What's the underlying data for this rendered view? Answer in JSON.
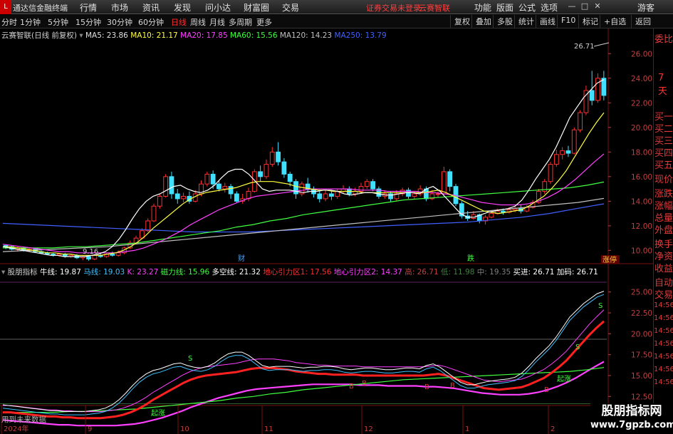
{
  "app": {
    "logo": "L",
    "title": "通达信金融终端"
  },
  "menu": [
    "行情",
    "市场",
    "资讯",
    "发现",
    "问小达",
    "财富圈",
    "交易"
  ],
  "notice": [
    "证券交易未登录",
    "云赛智联"
  ],
  "rmenu": [
    "功能",
    "版面",
    "公式",
    "选项"
  ],
  "guest": "游客",
  "window_icons": [
    "minimize-icon",
    "restore-icon",
    "close-icon"
  ],
  "periods": [
    "分时",
    "1分钟",
    "5分钟",
    "15分钟",
    "30分钟",
    "60分钟",
    "日线",
    "周线",
    "月线",
    "多周期",
    "更多"
  ],
  "active_period": "日线",
  "toolbar": [
    "复权",
    "叠加",
    "多股",
    "统计",
    "画线",
    "F10",
    "标记",
    "+自选",
    "返回"
  ],
  "legend_main": {
    "stock": "云赛智联(日线 前复权)",
    "ma5": "MA5: 23.86",
    "ma10": "MA10: 21.17",
    "ma20": "MA20: 17.85",
    "ma60": "MA60: 15.56",
    "ma120": "MA120: 14.23",
    "ma250": "MA250: 13.79"
  },
  "colors": {
    "ma5": "#ffffff",
    "ma10": "#ffff40",
    "ma20": "#ff40ff",
    "ma60": "#40ff40",
    "ma120": "#c0c0c0",
    "ma250": "#4060ff",
    "up": "#ff3030",
    "down": "#40e0ff",
    "axis": "#c04040"
  },
  "high_label": "26.71",
  "low_label": "9.16",
  "y_main": [
    "26.00",
    "24.00",
    "22.00",
    "20.00",
    "18.00",
    "16.00",
    "14.00",
    "12.00",
    "10.00"
  ],
  "main_markers": {
    "cai": "财",
    "die": "跌",
    "zhangting": "涨停"
  },
  "legend_ind": {
    "name": "股朋指标",
    "n1": "牛线: 19.87",
    "n2": "马线: 19.03",
    "n3": "K: 23.27",
    "n4": "磁力线: 15.96",
    "n5": "多空线: 21.32",
    "n6": "地心引力区1: 17.56",
    "n7": "地心引力区2: 14.37",
    "n8": "高: 26.71",
    "n9": "低: 11.98",
    "n10": "中: 19.35",
    "n11": "买进: 26.71",
    "n12": "加码: 26.71"
  },
  "y_ind": [
    "25.00",
    "22.50",
    "20.00",
    "17.50",
    "15.00",
    "12.50"
  ],
  "sell_signal": "S",
  "buy_signal": "B",
  "cross_signal": "起涨",
  "x_labels": [
    "2024年",
    "9",
    "10",
    "11",
    "12",
    "1",
    "2"
  ],
  "footer_text": "用到未来数据",
  "side_panel": {
    "top": "委比",
    "top_val": "7天",
    "items": [
      "买一",
      "买二",
      "买三",
      "买四",
      "买五",
      "现价",
      "涨跌",
      "涨幅",
      "总量",
      "外盘",
      "换手",
      "净资",
      "收益"
    ],
    "bottom": [
      "自动",
      "交易"
    ],
    "ticks": [
      "14:56",
      "14:56",
      "14:56",
      "14:56",
      "14:56",
      "14:56",
      "14:56"
    ]
  },
  "watermark": {
    "line1": "股朋指标网",
    "line2": "www.7gpzb.com"
  },
  "chart_data": {
    "type": "candlestick",
    "title": "云赛智联(日线 前复权)",
    "x": [
      "2024年",
      "9",
      "10",
      "11",
      "12",
      "1",
      "2"
    ],
    "ylim": [
      9.5,
      27
    ],
    "candles": [
      [
        10.4,
        10.3,
        10.5,
        10.1
      ],
      [
        10.3,
        10.1,
        10.4,
        10.0
      ],
      [
        10.1,
        10.2,
        10.3,
        9.9
      ],
      [
        10.2,
        10.0,
        10.3,
        9.9
      ],
      [
        10.0,
        10.1,
        10.2,
        9.9
      ],
      [
        10.1,
        9.9,
        10.2,
        9.8
      ],
      [
        9.9,
        9.8,
        10.0,
        9.7
      ],
      [
        9.8,
        9.7,
        9.9,
        9.6
      ],
      [
        9.7,
        9.6,
        9.8,
        9.5
      ],
      [
        9.6,
        9.7,
        9.8,
        9.5
      ],
      [
        9.7,
        9.5,
        9.8,
        9.4
      ],
      [
        9.5,
        9.6,
        9.7,
        9.4
      ],
      [
        9.6,
        9.4,
        9.7,
        9.3
      ],
      [
        9.4,
        9.5,
        9.6,
        9.2
      ],
      [
        9.5,
        9.3,
        9.6,
        9.16
      ],
      [
        9.3,
        9.6,
        9.7,
        9.2
      ],
      [
        9.6,
        9.5,
        9.8,
        9.4
      ],
      [
        9.5,
        9.7,
        9.8,
        9.4
      ],
      [
        9.7,
        9.6,
        9.9,
        9.5
      ],
      [
        9.6,
        9.8,
        10.0,
        9.5
      ],
      [
        9.8,
        10.2,
        10.3,
        9.7
      ],
      [
        10.2,
        10.6,
        10.8,
        10.1
      ],
      [
        10.6,
        11.0,
        11.2,
        10.5
      ],
      [
        11.0,
        11.6,
        11.8,
        10.9
      ],
      [
        11.6,
        12.4,
        12.6,
        11.5
      ],
      [
        12.4,
        13.6,
        13.8,
        12.3
      ],
      [
        13.6,
        14.4,
        14.6,
        13.4
      ],
      [
        14.4,
        16.0,
        16.2,
        14.3
      ],
      [
        16.0,
        14.6,
        16.4,
        14.2
      ],
      [
        14.6,
        14.2,
        15.0,
        13.8
      ],
      [
        14.2,
        14.4,
        14.7,
        13.9
      ],
      [
        14.4,
        14.0,
        14.8,
        13.8
      ],
      [
        14.0,
        14.6,
        14.9,
        13.9
      ],
      [
        14.6,
        15.4,
        15.7,
        14.4
      ],
      [
        15.4,
        16.2,
        16.4,
        15.2
      ],
      [
        16.2,
        15.4,
        16.5,
        15.0
      ],
      [
        15.4,
        15.0,
        15.7,
        14.8
      ],
      [
        15.0,
        15.2,
        15.5,
        14.7
      ],
      [
        15.2,
        14.6,
        15.4,
        14.2
      ],
      [
        14.6,
        14.0,
        14.8,
        13.9
      ],
      [
        14.0,
        14.2,
        14.6,
        13.8
      ],
      [
        14.2,
        14.8,
        15.1,
        14.0
      ],
      [
        14.8,
        16.4,
        16.6,
        14.7
      ],
      [
        16.4,
        16.0,
        16.9,
        15.6
      ],
      [
        16.0,
        17.0,
        17.4,
        15.8
      ],
      [
        17.0,
        18.0,
        18.4,
        16.8
      ],
      [
        18.0,
        17.2,
        18.8,
        16.9
      ],
      [
        17.2,
        16.2,
        17.5,
        15.9
      ],
      [
        16.2,
        15.6,
        16.4,
        15.2
      ],
      [
        15.6,
        14.6,
        15.8,
        14.2
      ],
      [
        14.6,
        15.4,
        15.6,
        14.4
      ],
      [
        15.4,
        15.0,
        15.9,
        14.7
      ],
      [
        15.0,
        14.6,
        15.2,
        14.3
      ],
      [
        14.6,
        14.2,
        14.8,
        13.9
      ],
      [
        14.2,
        14.6,
        14.9,
        14.0
      ],
      [
        14.6,
        14.4,
        14.9,
        14.1
      ],
      [
        14.4,
        14.8,
        15.0,
        14.2
      ],
      [
        14.8,
        15.0,
        15.3,
        14.6
      ],
      [
        15.0,
        14.6,
        15.2,
        14.4
      ],
      [
        14.6,
        14.8,
        15.1,
        14.4
      ],
      [
        14.8,
        15.2,
        15.5,
        14.6
      ],
      [
        15.2,
        15.6,
        15.8,
        15.0
      ],
      [
        15.6,
        15.0,
        15.8,
        14.8
      ],
      [
        15.0,
        14.4,
        15.2,
        14.2
      ],
      [
        14.4,
        14.6,
        14.9,
        14.2
      ],
      [
        14.6,
        14.2,
        14.8,
        13.9
      ],
      [
        14.2,
        14.6,
        14.9,
        14.0
      ],
      [
        14.6,
        14.9,
        15.1,
        14.4
      ],
      [
        14.9,
        14.4,
        15.1,
        14.2
      ],
      [
        14.4,
        14.6,
        14.8,
        14.2
      ],
      [
        14.6,
        15.0,
        15.3,
        14.4
      ],
      [
        15.0,
        14.2,
        15.2,
        14.0
      ],
      [
        14.2,
        14.6,
        14.9,
        14.1
      ],
      [
        14.6,
        14.6,
        14.8,
        14.3
      ],
      [
        14.6,
        16.4,
        16.8,
        14.5
      ],
      [
        16.4,
        15.2,
        16.6,
        14.8
      ],
      [
        15.2,
        13.8,
        15.4,
        13.6
      ],
      [
        13.8,
        12.8,
        14.0,
        12.6
      ],
      [
        12.8,
        12.6,
        13.2,
        12.4
      ],
      [
        12.6,
        12.9,
        13.2,
        12.5
      ],
      [
        12.9,
        12.4,
        13.0,
        12.2
      ],
      [
        12.4,
        12.7,
        12.9,
        12.1
      ],
      [
        12.7,
        13.0,
        13.2,
        12.6
      ],
      [
        13.0,
        13.2,
        13.4,
        12.9
      ],
      [
        13.2,
        13.1,
        13.4,
        12.9
      ],
      [
        13.1,
        13.3,
        13.5,
        13.0
      ],
      [
        13.3,
        13.4,
        13.6,
        13.1
      ],
      [
        13.4,
        13.2,
        13.7,
        13.0
      ],
      [
        13.2,
        13.5,
        13.7,
        13.1
      ],
      [
        13.5,
        13.9,
        14.1,
        13.4
      ],
      [
        13.9,
        14.8,
        15.0,
        13.8
      ],
      [
        14.8,
        15.6,
        15.8,
        14.6
      ],
      [
        15.6,
        17.0,
        17.2,
        15.4
      ],
      [
        17.0,
        17.8,
        18.2,
        16.8
      ],
      [
        17.8,
        18.1,
        18.4,
        17.4
      ],
      [
        18.1,
        17.9,
        18.5,
        17.6
      ],
      [
        17.9,
        19.8,
        20.0,
        17.8
      ],
      [
        19.8,
        21.2,
        21.4,
        19.6
      ],
      [
        21.2,
        23.0,
        23.4,
        21.0
      ],
      [
        23.0,
        22.2,
        24.6,
        21.8
      ],
      [
        22.2,
        24.0,
        24.4,
        22.0
      ],
      [
        24.0,
        22.6,
        24.6,
        22.2
      ]
    ],
    "ma5": [
      10.3,
      10.2,
      10.1,
      10.0,
      9.9,
      9.8,
      9.7,
      9.6,
      9.6,
      9.5,
      9.5,
      9.5,
      9.5,
      9.6,
      9.7,
      9.9,
      10.3,
      10.9,
      11.7,
      12.6,
      13.4,
      14.0,
      14.4,
      14.6,
      14.9,
      15.2,
      15.3,
      15.0,
      14.8,
      14.7,
      14.9,
      15.3,
      15.9,
      16.4,
      16.6,
      16.6,
      16.2,
      15.6,
      15.0,
      14.8,
      14.9,
      14.9,
      14.9,
      14.8,
      14.7,
      14.8,
      14.8,
      14.9,
      14.9,
      14.8,
      14.6,
      14.5,
      14.6,
      14.7,
      14.7,
      14.6,
      14.5,
      14.5,
      14.6,
      14.7,
      14.7,
      14.6,
      15.0,
      15.2,
      14.8,
      14.2,
      13.6,
      13.0,
      12.7,
      12.7,
      12.9,
      13.1,
      13.2,
      13.3,
      13.4,
      13.6,
      14.1,
      14.9,
      15.8,
      16.6,
      17.4,
      18.4,
      19.6,
      20.8,
      21.6,
      22.4,
      23.0,
      23.6,
      23.9
    ],
    "ma10": [
      10.3,
      10.3,
      10.2,
      10.1,
      10.0,
      9.9,
      9.8,
      9.8,
      9.7,
      9.7,
      9.6,
      9.6,
      9.6,
      9.6,
      9.7,
      9.8,
      10.0,
      10.3,
      10.7,
      11.2,
      11.8,
      12.3,
      12.8,
      13.3,
      13.8,
      14.2,
      14.5,
      14.7,
      14.8,
      14.9,
      15.0,
      15.1,
      15.3,
      15.5,
      15.6,
      15.6,
      15.6,
      15.5,
      15.4,
      15.2,
      15.1,
      15.0,
      14.9,
      14.9,
      14.8,
      14.8,
      14.8,
      14.8,
      14.7,
      14.7,
      14.7,
      14.7,
      14.7,
      14.7,
      14.7,
      14.7,
      14.7,
      14.8,
      14.9,
      14.7,
      14.4,
      14.1,
      13.8,
      13.5,
      13.2,
      13.1,
      13.0,
      13.1,
      13.2,
      13.3,
      13.6,
      14.0,
      14.4,
      15.0,
      15.7,
      16.5,
      17.5,
      18.5,
      19.5,
      20.4,
      21.2
    ],
    "ma20": [
      10.5,
      10.4,
      10.3,
      10.2,
      10.1,
      10.0,
      9.9,
      9.9,
      9.8,
      9.8,
      9.8,
      9.8,
      9.8,
      9.9,
      10.0,
      10.2,
      10.5,
      10.8,
      11.2,
      11.6,
      12.1,
      12.5,
      12.9,
      13.3,
      13.6,
      13.9,
      14.2,
      14.4,
      14.5,
      14.6,
      14.7,
      14.8,
      14.9,
      15.0,
      15.0,
      15.0,
      15.0,
      15.0,
      14.9,
      14.9,
      14.9,
      14.8,
      14.8,
      14.8,
      14.8,
      14.7,
      14.7,
      14.6,
      14.5,
      14.3,
      14.1,
      13.9,
      13.8,
      13.7,
      13.7,
      13.7,
      13.8,
      14.0,
      14.3,
      14.7,
      15.2,
      15.8,
      16.5,
      17.2,
      17.85
    ],
    "ma60": [
      10.2,
      10.2,
      10.2,
      10.2,
      10.3,
      10.3,
      10.4,
      10.5,
      10.6,
      10.8,
      11.0,
      11.2,
      11.4,
      11.6,
      11.9,
      12.1,
      12.4,
      12.6,
      12.9,
      13.1,
      13.3,
      13.5,
      13.7,
      13.9,
      14.1,
      14.2,
      14.3,
      14.4,
      14.5,
      14.6,
      14.7,
      14.8,
      14.9,
      15.0,
      15.1,
      15.3,
      15.56
    ],
    "ma120": [
      9.9,
      10.0,
      10.1,
      10.2,
      10.3,
      10.5,
      10.7,
      10.9,
      11.1,
      11.3,
      11.5,
      11.7,
      11.9,
      12.1,
      12.3,
      12.5,
      12.7,
      12.9,
      13.1,
      13.3,
      13.5,
      13.7,
      13.9,
      14.23
    ],
    "ma250": [
      12.2,
      12.1,
      12.0,
      11.9,
      11.8,
      11.7,
      11.6,
      11.5,
      11.5,
      11.5,
      11.6,
      11.7,
      11.8,
      11.9,
      12.0,
      12.1,
      12.2,
      12.3,
      12.5,
      12.7,
      13.0,
      13.4,
      13.79
    ]
  }
}
